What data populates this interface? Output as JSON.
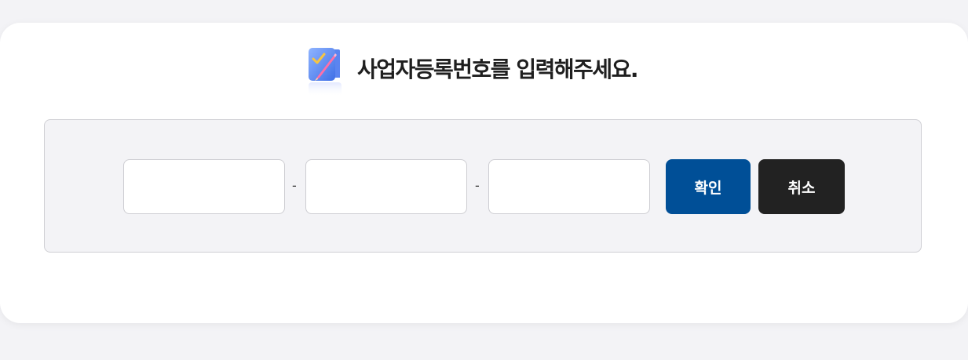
{
  "dialog": {
    "title": "사업자등록번호를 입력해주세요.",
    "title_icon": "pencil-checklist-icon"
  },
  "form": {
    "field1": {
      "value": "",
      "placeholder": ""
    },
    "separator1": "-",
    "field2": {
      "value": "",
      "placeholder": ""
    },
    "separator2": "-",
    "field3": {
      "value": "",
      "placeholder": ""
    },
    "confirm_label": "확인",
    "cancel_label": "취소"
  },
  "colors": {
    "page_background": "#f3f3f6",
    "confirm_button": "#004f97",
    "cancel_button": "#222222"
  }
}
